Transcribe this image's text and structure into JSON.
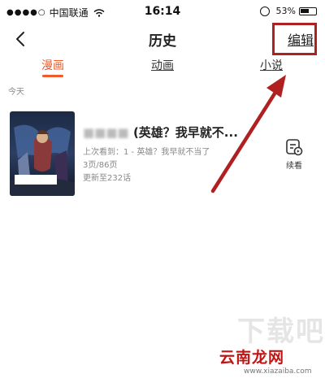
{
  "status_bar": {
    "signal": "●●●●○",
    "carrier": "中国联通",
    "time": "16:14",
    "battery": "53%"
  },
  "nav": {
    "title": "历史",
    "edit_label": "编辑"
  },
  "tabs": [
    {
      "label": "漫画",
      "active": true
    },
    {
      "label": "动画",
      "active": false
    },
    {
      "label": "小说",
      "active": false
    }
  ],
  "section_label": "今天",
  "history": [
    {
      "title_visible": "(英雄？我早就不...",
      "last_read": "上次看到：1 - 英雄？我早就不当了",
      "progress": "3页/86页",
      "updated": "更新至232话",
      "continue_label": "续看"
    }
  ],
  "colors": {
    "accent": "#f05a28",
    "annotation": "#b02020"
  },
  "watermark": {
    "main": "云南龙网",
    "url": "www.xiazaiba.com"
  }
}
